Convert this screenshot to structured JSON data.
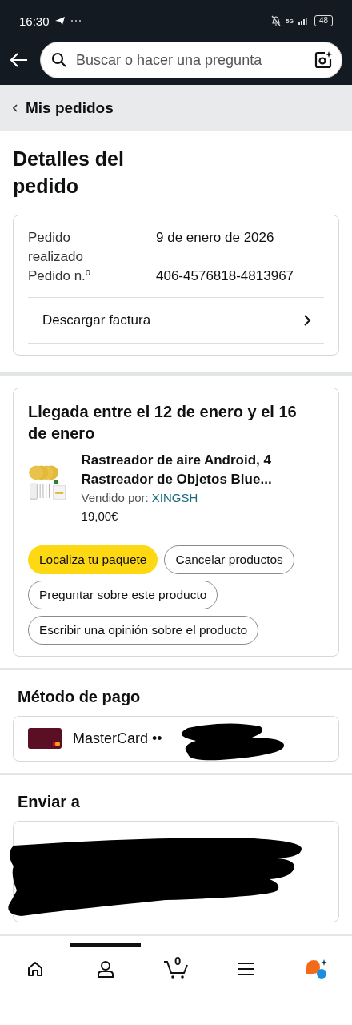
{
  "status_bar": {
    "time": "16:30",
    "network": "5G",
    "battery": "48"
  },
  "search": {
    "placeholder": "Buscar o hacer una pregunta"
  },
  "breadcrumb": "Mis pedidos",
  "title": "Detalles del pedido",
  "summary": {
    "rows": [
      {
        "label": "Pedido realizado",
        "value": "9 de enero de 2026"
      },
      {
        "label": "Pedido n.º",
        "value": "406-4576818-4813967"
      }
    ],
    "invoice_link": "Descargar factura"
  },
  "shipment": {
    "arrival": "Llegada entre el 12 de enero y el 16 de enero",
    "product": {
      "name": "Rastreador de aire Android, 4 Rastreador de Objetos Blue...",
      "seller_label": "Vendido por:",
      "seller": "XINGSH",
      "price": "19,00€"
    },
    "actions": [
      {
        "label": "Localiza tu paquete",
        "kind": "primary"
      },
      {
        "label": "Cancelar productos",
        "kind": "secondary"
      },
      {
        "label": "Preguntar sobre este producto",
        "kind": "secondary"
      },
      {
        "label": "Escribir una opinión sobre el producto",
        "kind": "secondary"
      }
    ]
  },
  "payment": {
    "heading": "Método de pago",
    "card": "MasterCard ••"
  },
  "shipping": {
    "heading": "Enviar a"
  },
  "nav": [
    {
      "kind": "home",
      "selected": false
    },
    {
      "kind": "account",
      "selected": true
    },
    {
      "kind": "cart",
      "selected": false,
      "count": "0"
    },
    {
      "kind": "menu",
      "selected": false
    },
    {
      "kind": "assistant",
      "selected": false
    }
  ]
}
